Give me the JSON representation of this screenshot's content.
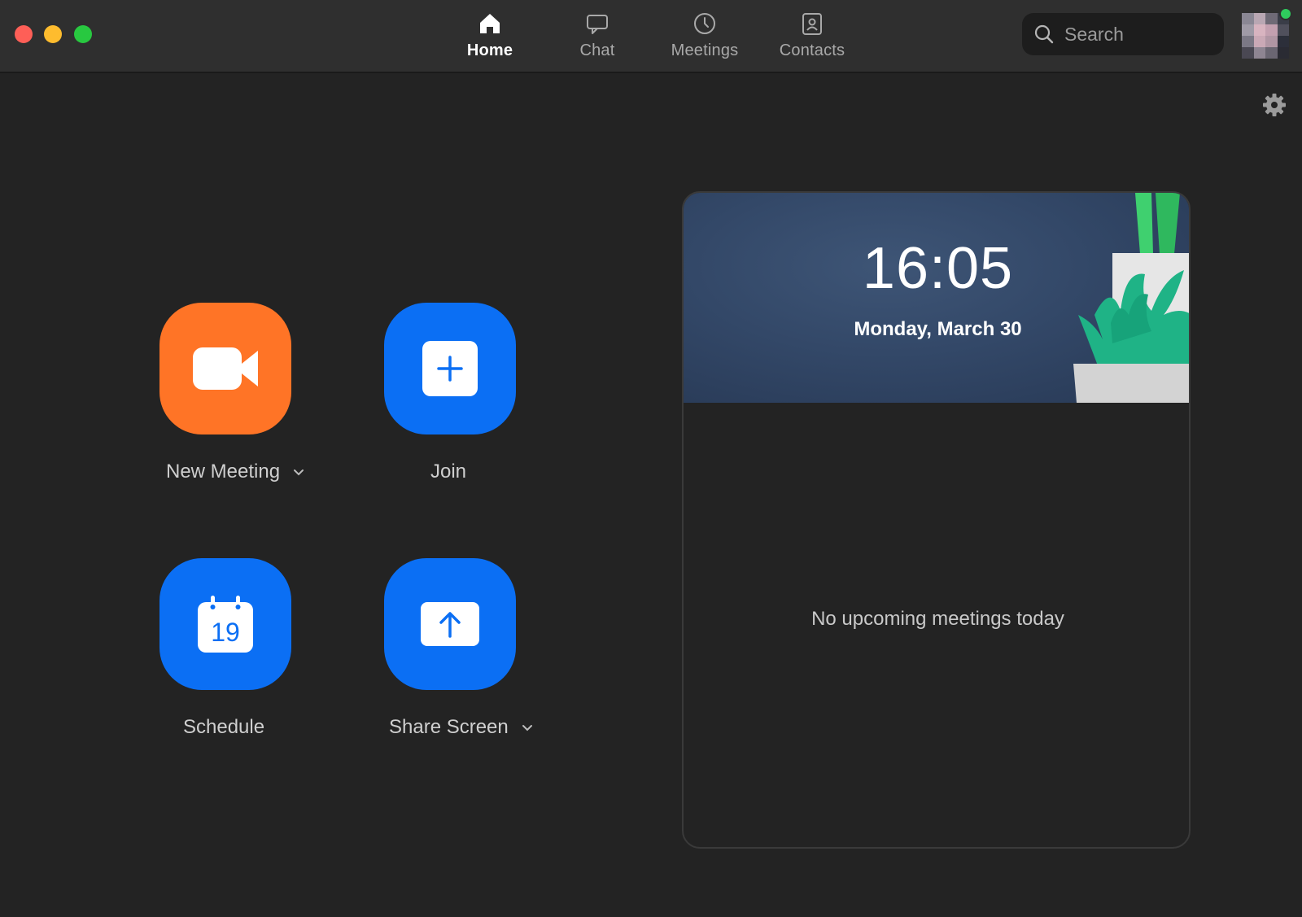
{
  "nav": {
    "tabs": [
      {
        "label": "Home",
        "icon": "home-icon",
        "active": true
      },
      {
        "label": "Chat",
        "icon": "chat-bubble-icon",
        "active": false
      },
      {
        "label": "Meetings",
        "icon": "clock-icon",
        "active": false
      },
      {
        "label": "Contacts",
        "icon": "contact-card-icon",
        "active": false
      }
    ]
  },
  "search": {
    "placeholder": "Search",
    "icon": "search-icon"
  },
  "actions": {
    "new_meeting": {
      "label": "New Meeting",
      "icon": "video-camera-icon",
      "has_dropdown": true
    },
    "join": {
      "label": "Join",
      "icon": "plus-icon",
      "has_dropdown": false
    },
    "schedule": {
      "label": "Schedule",
      "icon": "calendar-icon",
      "calendar_day": "19",
      "has_dropdown": false
    },
    "share_screen": {
      "label": "Share Screen",
      "icon": "share-arrow-icon",
      "has_dropdown": true
    }
  },
  "meetings_panel": {
    "time": "16:05",
    "date": "Monday, March 30",
    "empty_message": "No upcoming meetings today"
  },
  "colors": {
    "window_bg": "#232323",
    "titlebar_bg": "#2f2f2f",
    "orange_accent": "#ff7426",
    "blue_accent": "#0b6ff4",
    "banner_bg": "#334868",
    "presence": "#2fcc5d"
  }
}
